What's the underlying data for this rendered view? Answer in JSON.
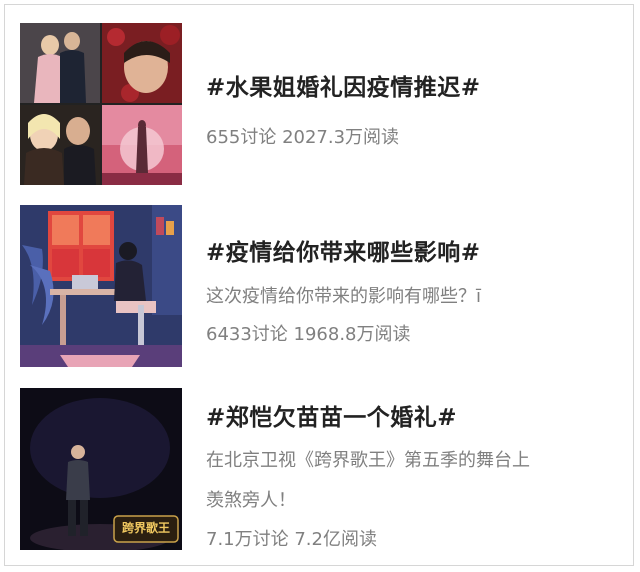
{
  "topics": [
    {
      "title": "#水果姐婚礼因疫情推迟#",
      "stats": "655讨论 2027.3万阅读",
      "thumb_icon": "wedding-collage-thumbnail"
    },
    {
      "title": "#疫情给你带来哪些影响#",
      "description": "这次疫情给你带来的影响有哪些？ī",
      "stats": "6433讨论 1968.8万阅读",
      "thumb_icon": "home-illustration-thumbnail"
    },
    {
      "title": "#郑恺欠苗苗一个婚礼#",
      "description_line1": "在北京卫视《跨界歌王》第五季的舞台上",
      "description_line2": "羡煞旁人！",
      "stats": "7.1万讨论 7.2亿阅读",
      "thumb_icon": "stage-singer-thumbnail",
      "thumb_logo": "跨界歌王"
    }
  ]
}
